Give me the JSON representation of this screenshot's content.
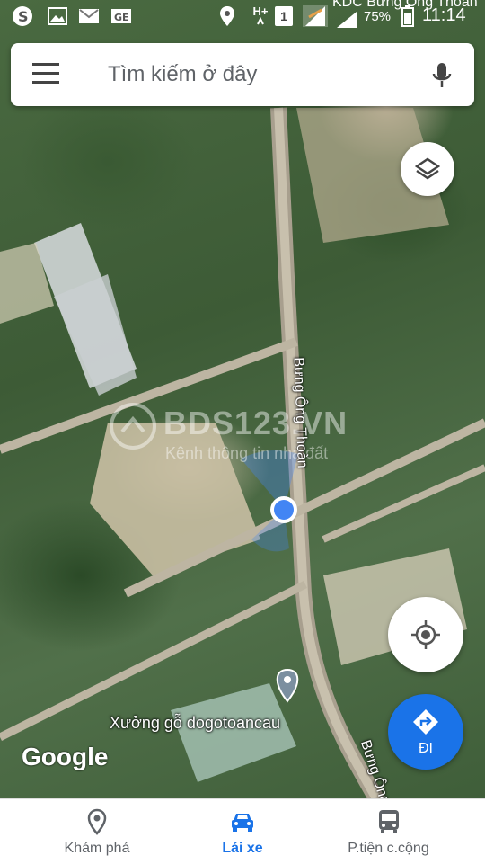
{
  "status_bar": {
    "carrier_text": "KDC Bưng Ông Thoàn",
    "sim_slot": "1",
    "network": "H+",
    "battery_percent": "75%",
    "clock": "11:14",
    "icons": [
      "skype-icon",
      "image-icon",
      "gmail-icon",
      "ge-icon",
      "location-icon",
      "network-hplus-icon",
      "sim-icon",
      "signal-icon",
      "signal-icon-2",
      "battery-icon"
    ]
  },
  "search": {
    "placeholder": "Tìm kiếm ở đây"
  },
  "map": {
    "watermark_title": "BDS123.VN",
    "watermark_subtitle": "Kênh thông tin nhà đất",
    "road_label_1": "Bưng Ông Thoàn",
    "road_label_2": "Bưng Ông",
    "place_label": "Xưởng gỗ dogotoancau",
    "logo": "Google"
  },
  "fab": {
    "go_label": "ĐI"
  },
  "bottom_nav": {
    "items": [
      {
        "label": "Khám phá",
        "icon": "explore-pin-icon",
        "active": false
      },
      {
        "label": "Lái xe",
        "icon": "car-icon",
        "active": true
      },
      {
        "label": "P.tiện c.cộng",
        "icon": "bus-icon",
        "active": false
      }
    ]
  },
  "colors": {
    "accent": "#1a73e8",
    "location_dot": "#4285f4"
  }
}
